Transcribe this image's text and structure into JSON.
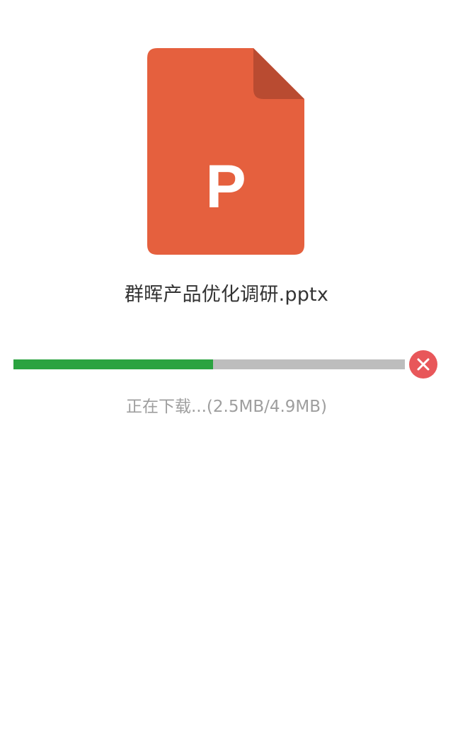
{
  "file": {
    "name": "群晖产品优化调研.pptx",
    "icon": "powerpoint-file-icon",
    "icon_letter": "P",
    "icon_color": "#e5603e",
    "icon_fold_color": "#b94b31"
  },
  "download": {
    "progress_fraction": 0.51,
    "status_text": "正在下载...(2.5MB/4.9MB)",
    "bar_fill_color": "#2ba340",
    "bar_track_color": "#bdbdbd",
    "cancel_icon": "close-icon",
    "cancel_color": "#e8575a"
  }
}
